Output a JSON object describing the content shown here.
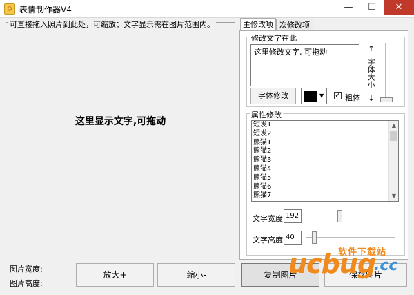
{
  "window": {
    "title": "表情制作器V4",
    "icon": "app-icon",
    "controls": [
      "minimize",
      "maximize",
      "close"
    ]
  },
  "canvas": {
    "caption": "可直接拖入照片到此处，可缩放；文字显示需在图片范围内。",
    "text": "这里显示文字,可拖动"
  },
  "info": {
    "width_label": "图片宽度:",
    "height_label": "图片高度:"
  },
  "buttons": {
    "zoom_in": "放大+",
    "zoom_out": "缩小-",
    "copy": "复制图片",
    "save": "保存图片"
  },
  "tabs": [
    {
      "label": "主修改项",
      "active": true
    },
    {
      "label": "次修改项",
      "active": false
    }
  ],
  "text_edit": {
    "legend": "修改文字在此",
    "value": "这里修改文字, 可拖动",
    "font_button": "字体修改",
    "color": "#000000",
    "bold_label": "粗体",
    "bold_checked": true,
    "font_size_label": "字体大小",
    "font_size_up": "↑",
    "font_size_down": "↓"
  },
  "attributes": {
    "legend": "属性修改",
    "items": [
      "短发1",
      "短发2",
      "熊猫1",
      "熊猫2",
      "熊猫3",
      "熊猫4",
      "熊猫5",
      "熊猫6",
      "熊猫7"
    ],
    "width_label": "文字宽度",
    "width_value": "192",
    "height_label": "文字高度",
    "height_value": "40"
  },
  "watermark": {
    "text_cn": "软件下载站",
    "text_en": "ucbug",
    "tld": ".cc"
  }
}
